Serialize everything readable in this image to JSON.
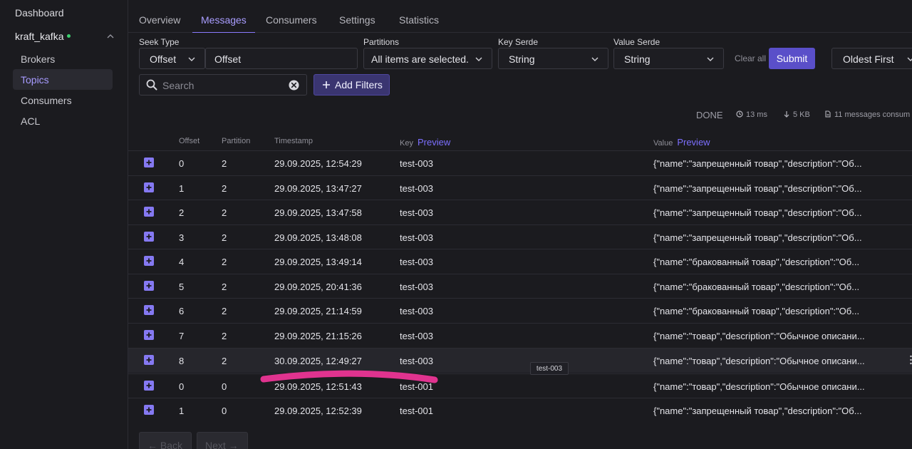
{
  "sidebar": {
    "dashboard": "Dashboard",
    "cluster": "kraft_kafka",
    "items": [
      {
        "label": "Brokers"
      },
      {
        "label": "Topics"
      },
      {
        "label": "Consumers"
      },
      {
        "label": "ACL"
      }
    ]
  },
  "tabs": [
    "Overview",
    "Messages",
    "Consumers",
    "Settings",
    "Statistics"
  ],
  "filters": {
    "seek_type_label": "Seek Type",
    "seek_type_value": "Offset",
    "seek_input_value": "Offset",
    "partitions_label": "Partitions",
    "partitions_value": "All items are selected.",
    "key_serde_label": "Key Serde",
    "key_serde_value": "String",
    "value_serde_label": "Value Serde",
    "value_serde_value": "String",
    "clear_all": "Clear all",
    "submit": "Submit",
    "sort_value": "Oldest First",
    "search_placeholder": "Search",
    "add_filters": "Add Filters"
  },
  "status": {
    "state": "DONE",
    "time": "13 ms",
    "size": "5 KB",
    "messages": "11 messages consum"
  },
  "table": {
    "headers": {
      "offset": "Offset",
      "partition": "Partition",
      "timestamp": "Timestamp",
      "key": "Key",
      "key_preview": "Preview",
      "value": "Value",
      "value_preview": "Preview"
    },
    "rows": [
      {
        "offset": "0",
        "partition": "2",
        "timestamp": "29.09.2025, 12:54:29",
        "key": "test-003",
        "value": "{\"name\":\"запрещенный товар\",\"description\":\"Об..."
      },
      {
        "offset": "1",
        "partition": "2",
        "timestamp": "29.09.2025, 13:47:27",
        "key": "test-003",
        "value": "{\"name\":\"запрещенный товар\",\"description\":\"Об..."
      },
      {
        "offset": "2",
        "partition": "2",
        "timestamp": "29.09.2025, 13:47:58",
        "key": "test-003",
        "value": "{\"name\":\"запрещенный товар\",\"description\":\"Об..."
      },
      {
        "offset": "3",
        "partition": "2",
        "timestamp": "29.09.2025, 13:48:08",
        "key": "test-003",
        "value": "{\"name\":\"запрещенный товар\",\"description\":\"Об..."
      },
      {
        "offset": "4",
        "partition": "2",
        "timestamp": "29.09.2025, 13:49:14",
        "key": "test-003",
        "value": "{\"name\":\"бракованный товар\",\"description\":\"Об..."
      },
      {
        "offset": "5",
        "partition": "2",
        "timestamp": "29.09.2025, 20:41:36",
        "key": "test-003",
        "value": "{\"name\":\"бракованный товар\",\"description\":\"Об..."
      },
      {
        "offset": "6",
        "partition": "2",
        "timestamp": "29.09.2025, 21:14:59",
        "key": "test-003",
        "value": "{\"name\":\"бракованный товар\",\"description\":\"Об..."
      },
      {
        "offset": "7",
        "partition": "2",
        "timestamp": "29.09.2025, 21:15:26",
        "key": "test-003",
        "value": "{\"name\":\"товар\",\"description\":\"Обычное описани..."
      },
      {
        "offset": "8",
        "partition": "2",
        "timestamp": "30.09.2025, 12:49:27",
        "key": "test-003",
        "value": "{\"name\":\"товар\",\"description\":\"Обычное описани..."
      },
      {
        "offset": "0",
        "partition": "0",
        "timestamp": "29.09.2025, 12:51:43",
        "key": "test-001",
        "value": "{\"name\":\"товар\",\"description\":\"Обычное описани..."
      },
      {
        "offset": "1",
        "partition": "0",
        "timestamp": "29.09.2025, 12:52:39",
        "key": "test-001",
        "value": "{\"name\":\"запрещенный товар\",\"description\":\"Об..."
      }
    ]
  },
  "tooltip": "test-003",
  "pager": {
    "back": "← Back",
    "next": "Next →"
  },
  "colors": {
    "accent": "#8579f2",
    "submit": "#5a4fc9",
    "status_dot": "#3ccf6e",
    "annotation": "#e0338f"
  }
}
